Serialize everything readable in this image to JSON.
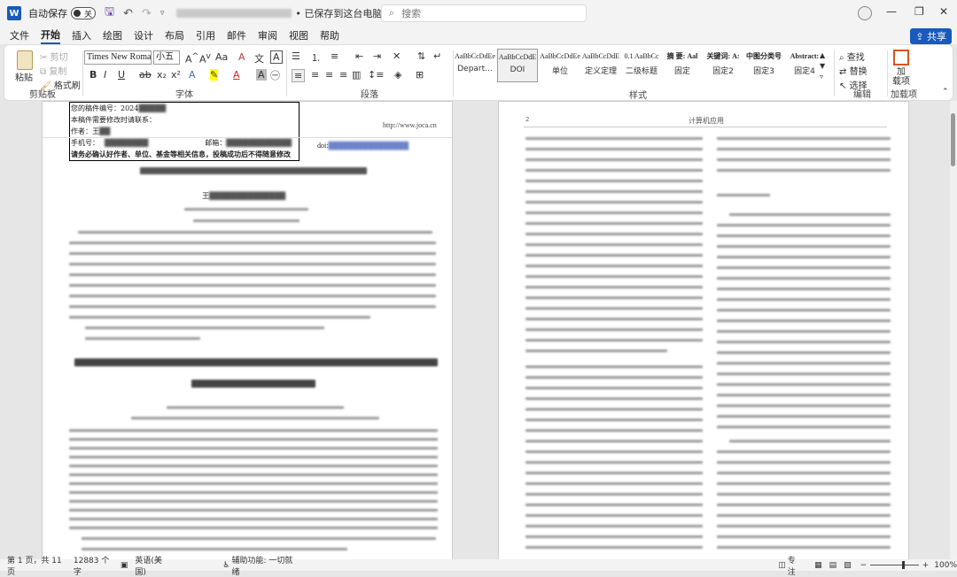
{
  "titlebar": {
    "autosave_label": "自动保存",
    "toggle_state": "关",
    "save_status": "• 已保存到这台电脑 ∨",
    "search_placeholder": "搜索"
  },
  "menu": {
    "items": [
      "文件",
      "开始",
      "插入",
      "绘图",
      "设计",
      "布局",
      "引用",
      "邮件",
      "审阅",
      "视图",
      "帮助"
    ],
    "active": "开始",
    "share_label": "共享"
  },
  "ribbon": {
    "clipboard": {
      "paste": "粘贴",
      "cut": "剪切",
      "copy": "复制",
      "format_painter": "格式刷",
      "label": "剪贴板"
    },
    "font": {
      "name": "Times New Roman",
      "size": "小五",
      "label": "字体"
    },
    "paragraph": {
      "label": "段落"
    },
    "styles": {
      "label": "样式",
      "items": [
        {
          "preview": "AaBbCcDdEe",
          "name": "Depart..."
        },
        {
          "preview": "AaBbCcDdE",
          "name": "DOI"
        },
        {
          "preview": "AaBbCcDdEe",
          "name": "单位"
        },
        {
          "preview": "AaBbCcDdE",
          "name": "定义定理"
        },
        {
          "preview": "0.1 AaBbCc",
          "name": "二级标题"
        },
        {
          "preview": "摘 要: Aal",
          "name": "固定"
        },
        {
          "preview": "关键词: A:",
          "name": "固定2"
        },
        {
          "preview": "中图分类号",
          "name": "固定3"
        },
        {
          "preview": "Abstract:",
          "name": "固定4"
        }
      ]
    },
    "editing": {
      "find": "查找",
      "replace": "替换",
      "select": "选择",
      "label": "编辑"
    },
    "addins": {
      "button": "加\n载项",
      "label": "加载项"
    }
  },
  "document": {
    "left_page": {
      "box_lines": [
        "您的稿件编号：2024",
        "本稿件需要修改时请联系：",
        "作者：王",
        "手机号：",
        "请务必确认好作者、单位、基金等相关信息，投稿成功后不得随意修改"
      ],
      "email_label": "邮箱：",
      "url": "http://www.joca.cn",
      "doi_label": "doi:",
      "author_prefix": "王"
    },
    "right_page": {
      "page_number": "2",
      "header": "计算机应用"
    }
  },
  "status": {
    "page": "第 1 页，共 11 页",
    "words": "12883 个字",
    "language": "英语(美国)",
    "accessibility": "辅助功能: 一切就绪",
    "focus": "专注",
    "zoom": "100%"
  }
}
